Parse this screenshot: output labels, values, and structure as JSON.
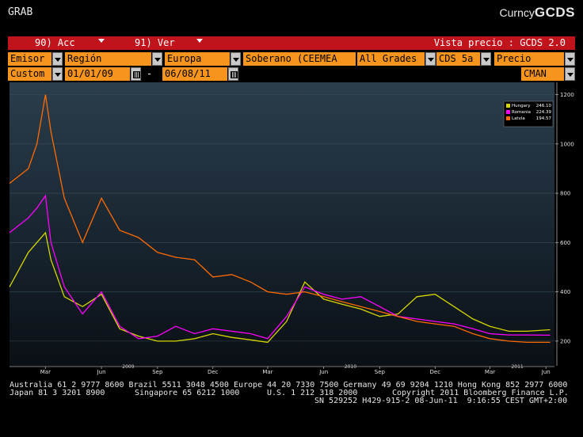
{
  "header": {
    "left_title": "GRAB",
    "right_prefix": "Curncy",
    "right_function": "GCDS"
  },
  "redbar": {
    "actions_label": "90) Acc",
    "views_label": "91) Ver",
    "right_text": "Vista precio : GCDS 2.0"
  },
  "filters_row1": {
    "issuer": "Emisor",
    "region_label": "Región",
    "region_value": "Europa",
    "sovereign": "Soberano (CEEMEA",
    "grades": "All Grades",
    "tenor": "CDS 5a",
    "measure": "Precio"
  },
  "filters_row2": {
    "range_type": "Custom",
    "start_date": "01/01/09",
    "separator": "-",
    "end_date": "06/08/11",
    "source": "CMAN"
  },
  "colors": {
    "Hungary": "#d6d600",
    "Romania": "#ff00ff",
    "Latvia": "#ff6a00",
    "accent_red": "#c0131c",
    "field_orange": "#f7941d"
  },
  "chart_data": {
    "type": "line",
    "ylim": [
      100,
      1250
    ],
    "y_ticks": [
      "200",
      "400",
      "600",
      "800",
      "1000",
      "1200"
    ],
    "x_ticks": [
      "Mar",
      "Jun",
      "Sep",
      "Dec",
      "Mar",
      "Jun",
      "Sep",
      "Dec",
      "Mar",
      "Jun"
    ],
    "year_labels": [
      "2009",
      "2010",
      "2011"
    ],
    "legend": [
      {
        "name": "Hungary",
        "value": "246.10"
      },
      {
        "name": "Romania",
        "value": "224.39"
      },
      {
        "name": "Latvia",
        "value": "194.57"
      }
    ],
    "x": [
      "2009-01-01",
      "2009-02-01",
      "2009-02-15",
      "2009-03-01",
      "2009-03-10",
      "2009-04-01",
      "2009-05-01",
      "2009-06-01",
      "2009-07-01",
      "2009-08-01",
      "2009-09-01",
      "2009-10-01",
      "2009-11-01",
      "2009-12-01",
      "2010-01-01",
      "2010-02-01",
      "2010-03-01",
      "2010-04-01",
      "2010-05-01",
      "2010-06-01",
      "2010-07-01",
      "2010-08-01",
      "2010-09-01",
      "2010-10-01",
      "2010-11-01",
      "2010-12-01",
      "2011-01-01",
      "2011-02-01",
      "2011-03-01",
      "2011-04-01",
      "2011-05-01",
      "2011-06-08"
    ],
    "series": [
      {
        "name": "Hungary",
        "values": [
          420,
          560,
          600,
          640,
          530,
          380,
          340,
          390,
          250,
          220,
          200,
          200,
          210,
          230,
          215,
          205,
          195,
          280,
          440,
          370,
          350,
          330,
          300,
          310,
          380,
          390,
          340,
          290,
          260,
          240,
          240,
          246
        ]
      },
      {
        "name": "Romania",
        "values": [
          640,
          700,
          740,
          790,
          600,
          420,
          310,
          400,
          260,
          210,
          220,
          260,
          230,
          250,
          240,
          230,
          210,
          300,
          420,
          390,
          370,
          380,
          340,
          300,
          290,
          280,
          270,
          250,
          230,
          225,
          225,
          224
        ]
      },
      {
        "name": "Latvia",
        "values": [
          840,
          900,
          1000,
          1200,
          1050,
          780,
          600,
          780,
          650,
          620,
          560,
          540,
          530,
          460,
          470,
          440,
          400,
          390,
          400,
          380,
          360,
          340,
          320,
          300,
          280,
          270,
          260,
          230,
          210,
          200,
          195,
          195
        ]
      }
    ]
  },
  "footer": {
    "line1": "Australia 61 2 9777 8600 Brazil 5511 3048 4500 Europe 44 20 7330 7500 Germany 49 69 9204 1210 Hong Kong 852 2977 6000",
    "line2_left": "Japan 81 3 3201 8900",
    "line2_mid": "Singapore 65 6212 1000",
    "line2_us": "U.S. 1 212 318 2000",
    "line2_right": "Copyright 2011 Bloomberg Finance L.P.",
    "line3": "SN 529252 H429-915-2 08-Jun-11  9:16:55 CEST GMT+2:00"
  }
}
